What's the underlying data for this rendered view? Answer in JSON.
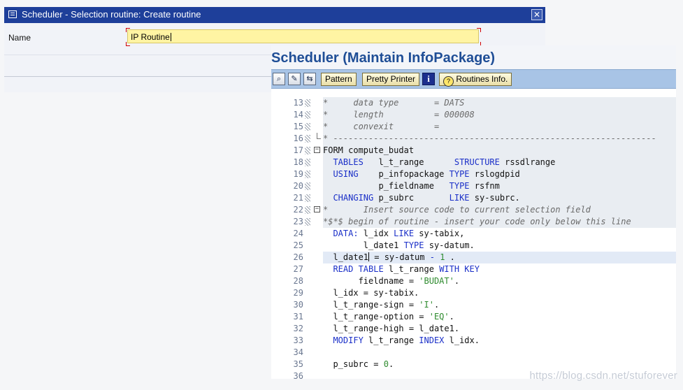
{
  "dialog": {
    "title": "Scheduler - Selection routine: Create routine",
    "close_icon": "close-icon",
    "name_label": "Name",
    "name_value": "IP Routine"
  },
  "editor": {
    "title": "Scheduler (Maintain InfoPackage)",
    "toolbar": {
      "icons": [
        "find-icon",
        "display-change-icon",
        "check-icon"
      ],
      "pattern_label": "Pattern",
      "pretty_printer_label": "Pretty Printer",
      "info_label": "i",
      "routines_info_label": "Routines Info."
    }
  },
  "code_lines": [
    {
      "n": "13",
      "mark": true,
      "fold": "",
      "bg": "grey",
      "parts": [
        [
          "cm",
          "*     data type       = DATS"
        ]
      ]
    },
    {
      "n": "14",
      "mark": true,
      "fold": "",
      "bg": "grey",
      "parts": [
        [
          "cm",
          "*     length          = 000008"
        ]
      ]
    },
    {
      "n": "15",
      "mark": true,
      "fold": "",
      "bg": "grey",
      "parts": [
        [
          "cm",
          "*     convexit        ="
        ]
      ]
    },
    {
      "n": "16",
      "mark": true,
      "fold": "end",
      "bg": "grey",
      "parts": [
        [
          "cm",
          "* ----------------------------------------------------------------"
        ]
      ]
    },
    {
      "n": "17",
      "mark": true,
      "fold": "minus",
      "bg": "grey",
      "parts": [
        [
          "tx",
          "FORM compute_budat"
        ]
      ]
    },
    {
      "n": "18",
      "mark": true,
      "fold": "",
      "bg": "grey",
      "parts": [
        [
          "kw",
          "  TABLES"
        ],
        [
          "tx",
          "   l_t_range      "
        ],
        [
          "kw",
          "STRUCTURE"
        ],
        [
          "tx",
          " rssdlrange"
        ]
      ]
    },
    {
      "n": "19",
      "mark": true,
      "fold": "",
      "bg": "grey",
      "parts": [
        [
          "kw",
          "  USING"
        ],
        [
          "tx",
          "    p_infopackage "
        ],
        [
          "kw",
          "TYPE"
        ],
        [
          "tx",
          " rslogdpid"
        ]
      ]
    },
    {
      "n": "20",
      "mark": true,
      "fold": "",
      "bg": "grey",
      "parts": [
        [
          "tx",
          "           p_fieldname   "
        ],
        [
          "kw",
          "TYPE"
        ],
        [
          "tx",
          " rsfnm"
        ]
      ]
    },
    {
      "n": "21",
      "mark": true,
      "fold": "",
      "bg": "grey",
      "parts": [
        [
          "kw",
          "  CHANGING"
        ],
        [
          "tx",
          " p_subrc       "
        ],
        [
          "kw",
          "LIKE"
        ],
        [
          "tx",
          " sy-subrc."
        ]
      ]
    },
    {
      "n": "22",
      "mark": true,
      "fold": "minus",
      "bg": "grey",
      "parts": [
        [
          "cm",
          "*       Insert source code to current selection field"
        ]
      ]
    },
    {
      "n": "23",
      "mark": true,
      "fold": "",
      "bg": "grey",
      "parts": [
        [
          "cm",
          "*$*$ begin of routine - insert your code only below this line"
        ]
      ]
    },
    {
      "n": "24",
      "mark": false,
      "fold": "",
      "bg": "",
      "parts": [
        [
          "kw",
          "  DATA:"
        ],
        [
          "tx",
          " l_idx "
        ],
        [
          "kw",
          "LIKE"
        ],
        [
          "tx",
          " sy-tabix,"
        ]
      ]
    },
    {
      "n": "25",
      "mark": false,
      "fold": "",
      "bg": "",
      "parts": [
        [
          "tx",
          "        l_date1 "
        ],
        [
          "kw",
          "TYPE"
        ],
        [
          "tx",
          " sy-datum."
        ]
      ]
    },
    {
      "n": "26",
      "mark": false,
      "fold": "",
      "bg": "cur",
      "parts": [
        [
          "tx",
          "  l_date1"
        ],
        [
          "caret",
          ""
        ],
        [
          "tx",
          " = sy-datum "
        ],
        [
          "kw",
          "-"
        ],
        [
          "tx",
          " "
        ],
        [
          "nm",
          "1"
        ],
        [
          "tx",
          " ."
        ]
      ]
    },
    {
      "n": "27",
      "mark": false,
      "fold": "",
      "bg": "",
      "parts": [
        [
          "kw",
          "  READ TABLE"
        ],
        [
          "tx",
          " l_t_range "
        ],
        [
          "kw",
          "WITH KEY"
        ]
      ]
    },
    {
      "n": "28",
      "mark": false,
      "fold": "",
      "bg": "",
      "parts": [
        [
          "tx",
          "       fieldname = "
        ],
        [
          "st",
          "'BUDAT'"
        ],
        [
          "tx",
          "."
        ]
      ]
    },
    {
      "n": "29",
      "mark": false,
      "fold": "",
      "bg": "",
      "parts": [
        [
          "tx",
          "  l_idx = sy-tabix."
        ]
      ]
    },
    {
      "n": "30",
      "mark": false,
      "fold": "",
      "bg": "",
      "parts": [
        [
          "tx",
          "  l_t_range-sign = "
        ],
        [
          "st",
          "'I'"
        ],
        [
          "tx",
          "."
        ]
      ]
    },
    {
      "n": "31",
      "mark": false,
      "fold": "",
      "bg": "",
      "parts": [
        [
          "tx",
          "  l_t_range-option = "
        ],
        [
          "st",
          "'EQ'"
        ],
        [
          "tx",
          "."
        ]
      ]
    },
    {
      "n": "32",
      "mark": false,
      "fold": "",
      "bg": "",
      "parts": [
        [
          "tx",
          "  l_t_range-high = l_date1."
        ]
      ]
    },
    {
      "n": "33",
      "mark": false,
      "fold": "",
      "bg": "",
      "parts": [
        [
          "kw",
          "  MODIFY"
        ],
        [
          "tx",
          " l_t_range "
        ],
        [
          "kw",
          "INDEX"
        ],
        [
          "tx",
          " l_idx."
        ]
      ]
    },
    {
      "n": "34",
      "mark": false,
      "fold": "",
      "bg": "",
      "parts": [
        [
          "tx",
          ""
        ]
      ]
    },
    {
      "n": "35",
      "mark": false,
      "fold": "",
      "bg": "",
      "parts": [
        [
          "tx",
          "  p_subrc = "
        ],
        [
          "nm",
          "0"
        ],
        [
          "tx",
          "."
        ]
      ]
    },
    {
      "n": "36",
      "mark": false,
      "fold": "",
      "bg": "",
      "parts": [
        [
          "tx",
          ""
        ]
      ]
    }
  ],
  "watermark": "https://blog.csdn.net/stuforever"
}
